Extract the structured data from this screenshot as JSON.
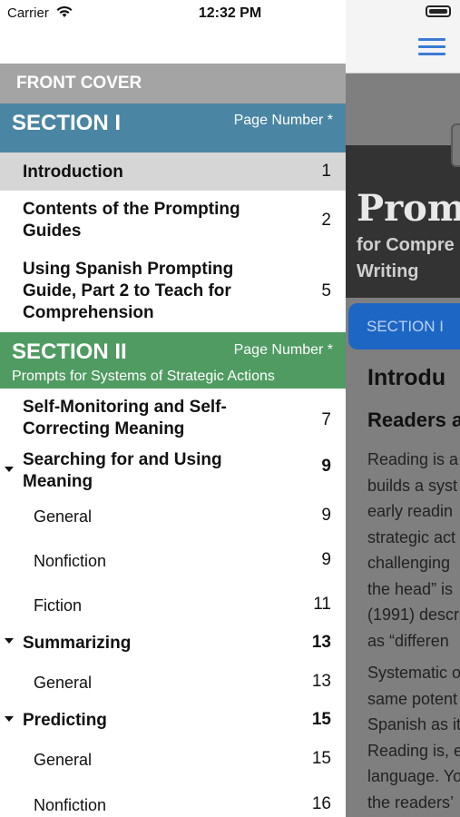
{
  "status": {
    "carrier": "Carrier",
    "time": "12:32 PM"
  },
  "nav": {
    "front_cover": "FRONT COVER",
    "section1": {
      "title": "SECTION I",
      "page_label": "Page Number *",
      "color": "#4a86a3"
    },
    "section1_items": [
      {
        "label": "Introduction",
        "page": "1"
      },
      {
        "label": "Contents of the Prompting Guides",
        "page": "2"
      },
      {
        "label": "Using Spanish Prompting Guide, Part 2 to Teach for Comprehension",
        "page": "5"
      }
    ],
    "section2": {
      "title": "SECTION II",
      "page_label": "Page Number *",
      "subtitle": "Prompts for Systems of Strategic Actions",
      "color": "#4f9b62"
    },
    "section2_items": [
      {
        "label": "Self-Monitoring and Self-Correcting Meaning",
        "page": "7"
      },
      {
        "label": "Searching for and Using Meaning",
        "page": "9"
      },
      {
        "label": "General",
        "page": "9"
      },
      {
        "label": "Nonfiction",
        "page": "9"
      },
      {
        "label": "Fiction",
        "page": "11"
      },
      {
        "label": "Summarizing",
        "page": "13"
      },
      {
        "label": "General",
        "page": "13"
      },
      {
        "label": "Predicting",
        "page": "15"
      },
      {
        "label": "General",
        "page": "15"
      },
      {
        "label": "Nonfiction",
        "page": "16"
      }
    ]
  },
  "content": {
    "banner_title": "Promp",
    "banner_sub1": "for Compre",
    "banner_sub2": "Writing",
    "section_tab": "SECTION I",
    "heading": "Introdu",
    "subheading": "Readers a",
    "para1": [
      "Reading is a",
      "builds a syst",
      "early readin",
      "strategic act",
      "challenging",
      "the head” is",
      "(1991) descr",
      "as “differen"
    ],
    "para2": [
      "Systematic o",
      "same potent",
      "Spanish as it",
      "Reading is, e",
      "language. Yo",
      "the readers’"
    ]
  },
  "icons": {
    "wifi": "wifi-icon",
    "battery": "battery-icon",
    "menu": "hamburger-menu-icon",
    "disclosure": "disclosure-triangle-icon"
  }
}
